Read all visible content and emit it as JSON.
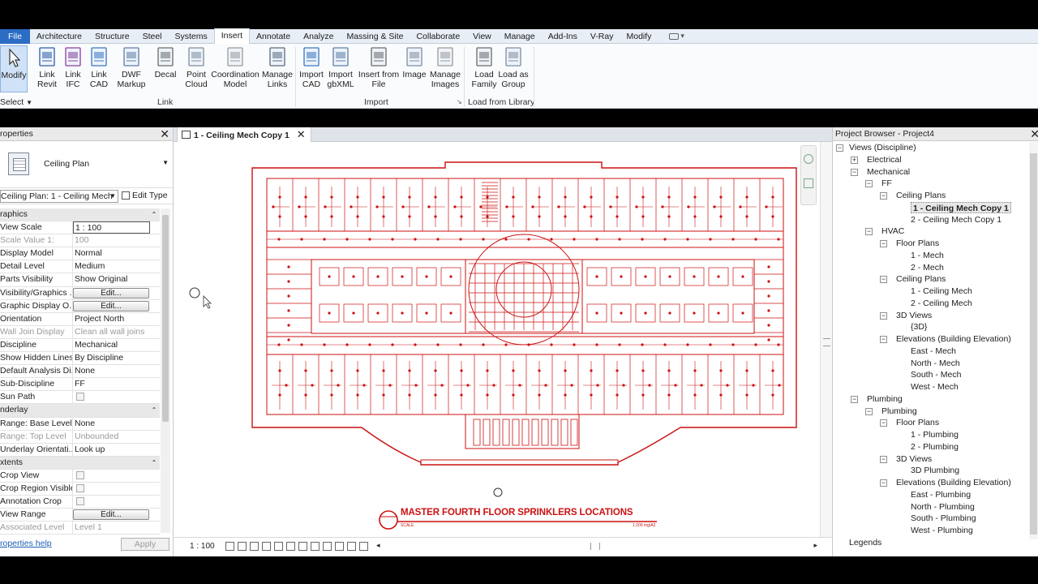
{
  "ribbon": {
    "tabs": [
      "File",
      "Architecture",
      "Structure",
      "Steel",
      "Systems",
      "Insert",
      "Annotate",
      "Analyze",
      "Massing & Site",
      "Collaborate",
      "View",
      "Manage",
      "Add-Ins",
      "V-Ray",
      "Modify"
    ],
    "active_tab": "Insert",
    "modify": {
      "label": "Modify",
      "select_label": "Select"
    },
    "link_group": {
      "label": "Link",
      "buttons": [
        "Link Revit",
        "Link IFC",
        "Link CAD",
        "DWF Markup",
        "Decal",
        "Point Cloud",
        "Coordination Model",
        "Manage Links"
      ]
    },
    "import_group": {
      "label": "Import",
      "buttons": [
        "Import CAD",
        "Import gbXML",
        "Insert from File",
        "Image",
        "Manage Images"
      ]
    },
    "library_group": {
      "label": "Load from Library",
      "buttons": [
        "Load Family",
        "Load as Group"
      ]
    }
  },
  "properties": {
    "title": "roperties",
    "type_name": "Ceiling Plan",
    "instance_selector": "Ceiling Plan: 1 - Ceiling Mech",
    "edit_type": "Edit Type",
    "sections": {
      "graphics": "raphics",
      "underlay": "nderlay",
      "extents": "xtents"
    },
    "graphics_rows": [
      {
        "k": "View Scale",
        "v": "1 : 100",
        "kind": "input"
      },
      {
        "k": "Scale Value    1:",
        "v": "100",
        "kind": "dim"
      },
      {
        "k": "Display Model",
        "v": "Normal"
      },
      {
        "k": "Detail Level",
        "v": "Medium"
      },
      {
        "k": "Parts Visibility",
        "v": "Show Original"
      },
      {
        "k": "Visibility/Graphics ...",
        "v": "Edit...",
        "kind": "button"
      },
      {
        "k": "Graphic Display O...",
        "v": "Edit...",
        "kind": "button"
      },
      {
        "k": "Orientation",
        "v": "Project North"
      },
      {
        "k": "Wall Join Display",
        "v": "Clean all wall joins",
        "kind": "dim"
      },
      {
        "k": "Discipline",
        "v": "Mechanical"
      },
      {
        "k": "Show Hidden Lines",
        "v": "By Discipline"
      },
      {
        "k": "Default Analysis Di...",
        "v": "None"
      },
      {
        "k": "Sub-Discipline",
        "v": "FF"
      },
      {
        "k": "Sun Path",
        "v": "",
        "kind": "check"
      }
    ],
    "underlay_rows": [
      {
        "k": "Range: Base Level",
        "v": "None"
      },
      {
        "k": "Range: Top Level",
        "v": "Unbounded",
        "kind": "dim"
      },
      {
        "k": "Underlay Orientati...",
        "v": "Look up"
      }
    ],
    "extents_rows": [
      {
        "k": "Crop View",
        "v": "",
        "kind": "check"
      },
      {
        "k": "Crop Region Visible",
        "v": "",
        "kind": "check"
      },
      {
        "k": "Annotation Crop",
        "v": "",
        "kind": "check"
      },
      {
        "k": "View Range",
        "v": "Edit...",
        "kind": "button"
      },
      {
        "k": "Associated Level",
        "v": "Level 1",
        "kind": "dim"
      }
    ],
    "help_link": "roperties help",
    "apply": "Apply"
  },
  "view": {
    "tab_title": "1 - Ceiling Mech Copy 1",
    "scale": "1 : 100",
    "drawing_title": "MASTER FOURTH FLOOR SPRINKLERS LOCATIONS",
    "drawing_scale_label": "SCALE",
    "drawing_scale_value": "1:200 mg/A2",
    "colors": {
      "drawing": "#cc1111",
      "canvas": "#ffffff"
    }
  },
  "browser": {
    "title": "Project Browser - Project4",
    "nodes": [
      {
        "label": "Views (Discipline)",
        "level": 0,
        "exp": "-"
      },
      {
        "label": "Electrical",
        "level": 1,
        "exp": "+"
      },
      {
        "label": "Mechanical",
        "level": 1,
        "exp": "-"
      },
      {
        "label": "FF",
        "level": 2,
        "exp": "-"
      },
      {
        "label": "Ceiling Plans",
        "level": 3,
        "exp": "-"
      },
      {
        "label": "1 - Ceiling Mech Copy 1",
        "level": 4,
        "selected": true
      },
      {
        "label": "2 - Ceiling Mech Copy 1",
        "level": 4
      },
      {
        "label": "HVAC",
        "level": 2,
        "exp": "-"
      },
      {
        "label": "Floor Plans",
        "level": 3,
        "exp": "-"
      },
      {
        "label": "1 - Mech",
        "level": 4
      },
      {
        "label": "2 - Mech",
        "level": 4
      },
      {
        "label": "Ceiling Plans",
        "level": 3,
        "exp": "-"
      },
      {
        "label": "1 - Ceiling Mech",
        "level": 4
      },
      {
        "label": "2 - Ceiling Mech",
        "level": 4
      },
      {
        "label": "3D Views",
        "level": 3,
        "exp": "-"
      },
      {
        "label": "{3D}",
        "level": 4
      },
      {
        "label": "Elevations (Building Elevation)",
        "level": 3,
        "exp": "-"
      },
      {
        "label": "East - Mech",
        "level": 4
      },
      {
        "label": "North - Mech",
        "level": 4
      },
      {
        "label": "South - Mech",
        "level": 4
      },
      {
        "label": "West - Mech",
        "level": 4
      },
      {
        "label": "Plumbing",
        "level": 1,
        "exp": "-"
      },
      {
        "label": "Plumbing",
        "level": 2,
        "exp": "-"
      },
      {
        "label": "Floor Plans",
        "level": 3,
        "exp": "-"
      },
      {
        "label": "1 - Plumbing",
        "level": 4
      },
      {
        "label": "2 - Plumbing",
        "level": 4
      },
      {
        "label": "3D Views",
        "level": 3,
        "exp": "-"
      },
      {
        "label": "3D Plumbing",
        "level": 4
      },
      {
        "label": "Elevations (Building Elevation)",
        "level": 3,
        "exp": "-"
      },
      {
        "label": "East - Plumbing",
        "level": 4
      },
      {
        "label": "North - Plumbing",
        "level": 4
      },
      {
        "label": "South - Plumbing",
        "level": 4
      },
      {
        "label": "West - Plumbing",
        "level": 4
      },
      {
        "label": "Legends",
        "level": 0
      }
    ]
  }
}
